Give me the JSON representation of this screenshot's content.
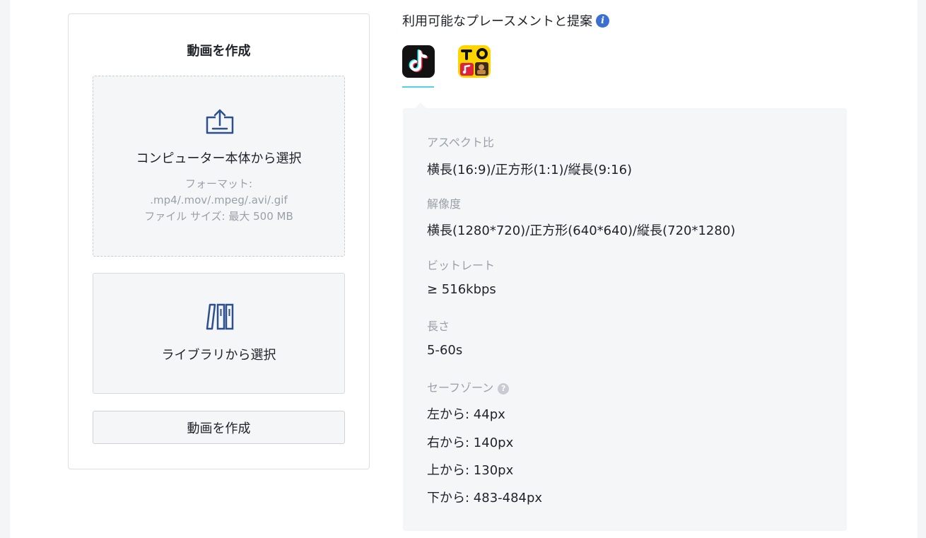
{
  "create_card": {
    "title": "動画を作成",
    "upload": {
      "icon": "upload-icon",
      "title": "コンピューター本体から選択",
      "format_label": "フォーマット:",
      "formats": ".mp4/.mov/.mpeg/.avi/.gif",
      "size_limit": "ファイル サイズ: 最大 500 MB"
    },
    "library": {
      "icon": "library-icon",
      "title": "ライブラリから選択"
    },
    "create_button_label": "動画を作成"
  },
  "placements": {
    "heading": "利用可能なプレースメントと提案",
    "info_glyph": "i",
    "tabs": [
      {
        "name": "tiktok",
        "icon": "tiktok-icon",
        "selected": true
      },
      {
        "name": "topbuzz",
        "icon": "topbuzz-icon",
        "selected": false
      }
    ],
    "accent_color": "#4fd3e0"
  },
  "specs": {
    "aspect_ratio": {
      "label": "アスペクト比",
      "value": "横長(16:9)/正方形(1:1)/縦長(9:16)"
    },
    "resolution": {
      "label": "解像度",
      "value": "横長(1280*720)/正方形(640*640)/縦長(720*1280)"
    },
    "bitrate": {
      "label": "ビットレート",
      "value": "≥ 516kbps"
    },
    "duration": {
      "label": "長さ",
      "value": "5-60s"
    },
    "safe_zone": {
      "label": "セーフゾーン",
      "help_glyph": "?",
      "left": "左から: 44px",
      "right": "右から: 140px",
      "top": "上から: 130px",
      "bottom": "下から: 483-484px"
    }
  }
}
